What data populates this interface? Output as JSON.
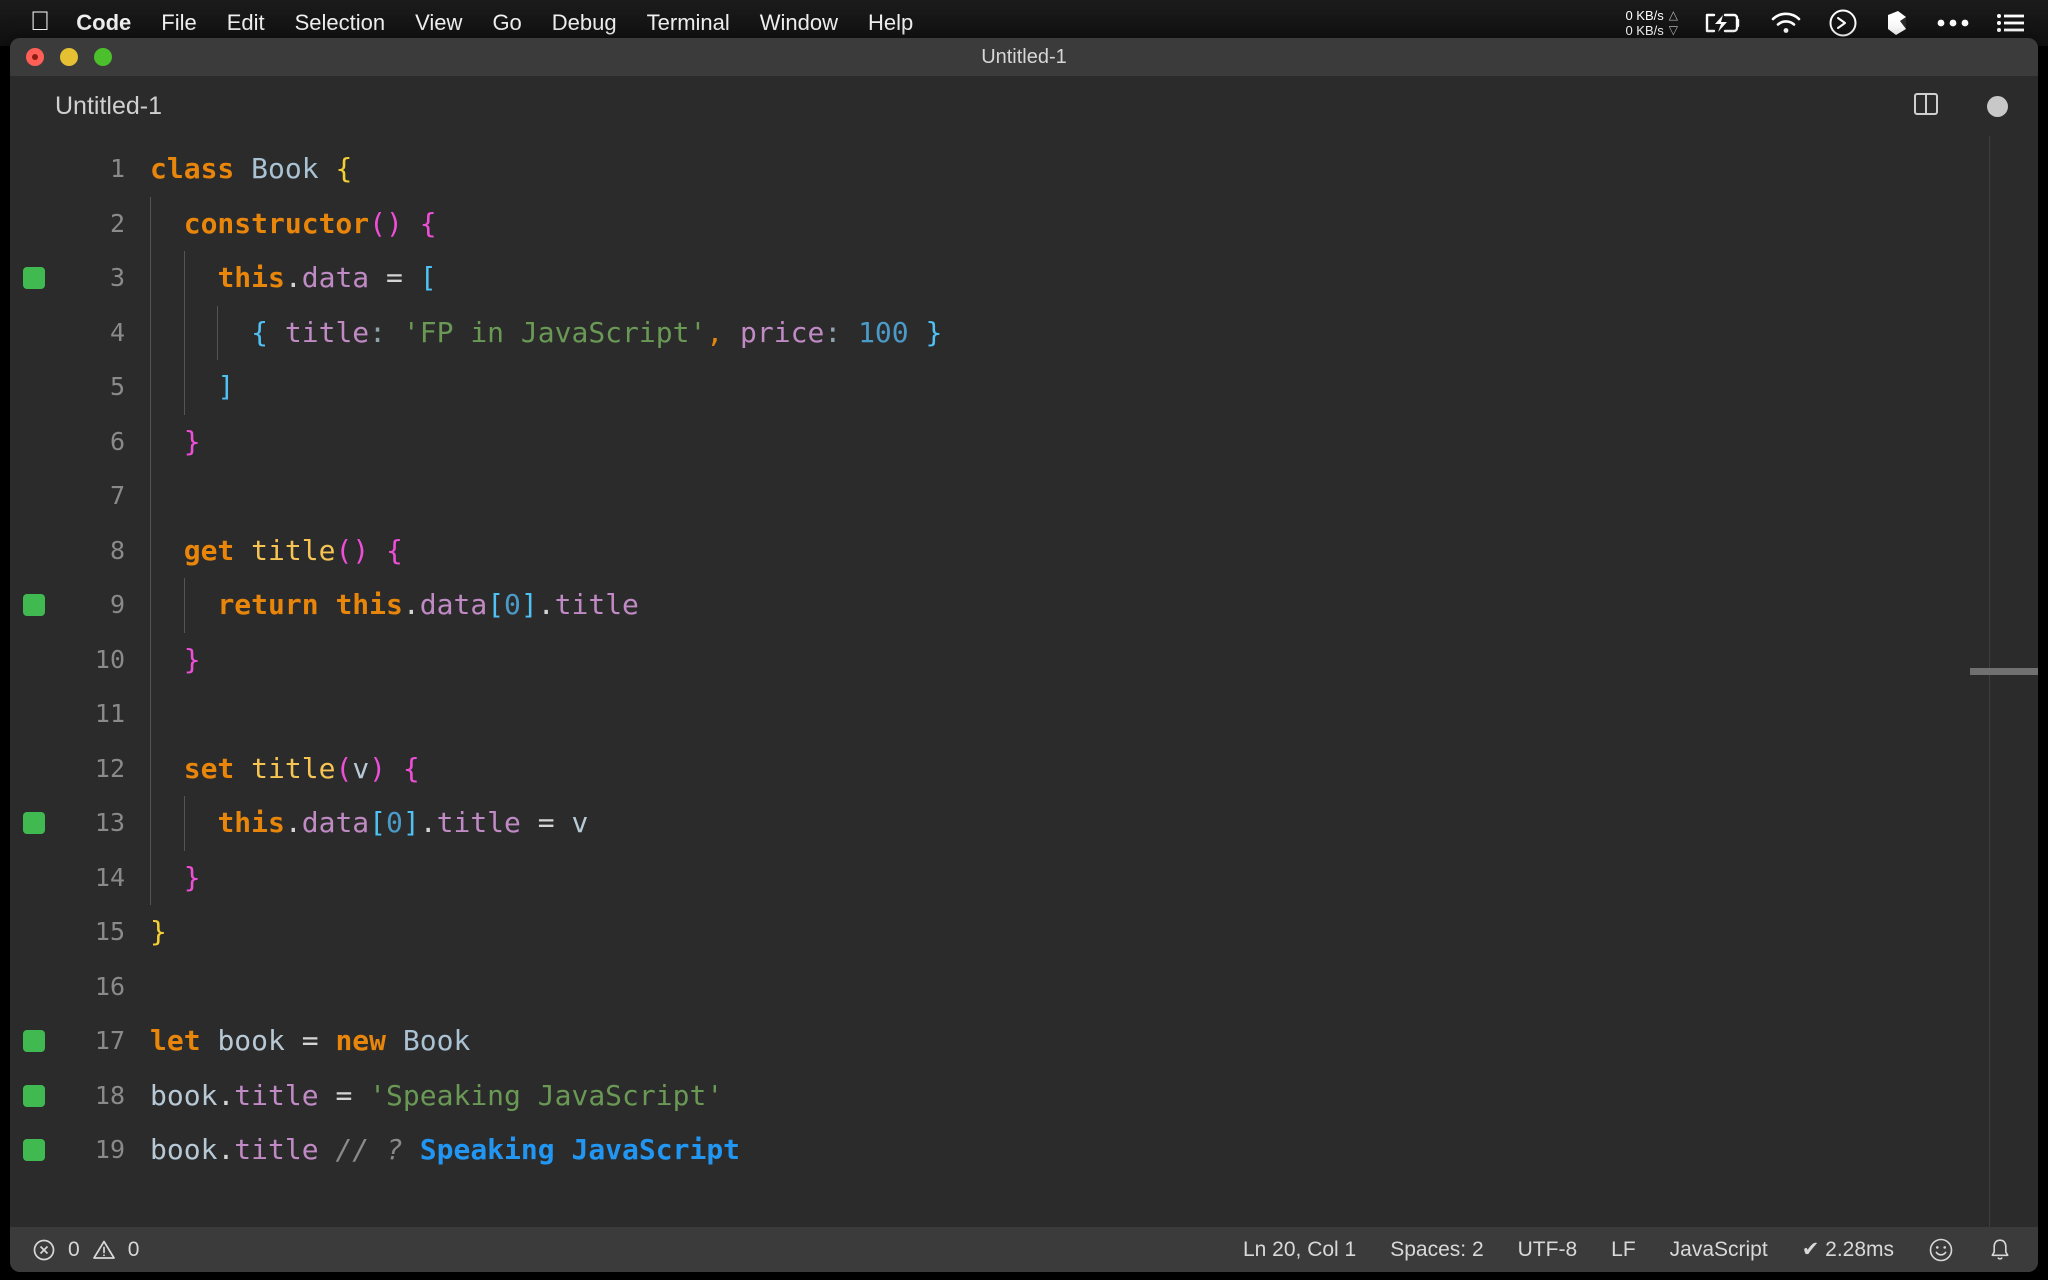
{
  "menubar": {
    "apple_icon": "apple-logo-icon",
    "items": [
      {
        "label": "Code",
        "bold": true
      },
      {
        "label": "File",
        "bold": false
      },
      {
        "label": "Edit",
        "bold": false
      },
      {
        "label": "Selection",
        "bold": false
      },
      {
        "label": "View",
        "bold": false
      },
      {
        "label": "Go",
        "bold": false
      },
      {
        "label": "Debug",
        "bold": false
      },
      {
        "label": "Terminal",
        "bold": false
      },
      {
        "label": "Window",
        "bold": false
      },
      {
        "label": "Help",
        "bold": false
      }
    ],
    "network": {
      "up": "0 KB/s",
      "down": "0 KB/s",
      "up_arrow": "△",
      "down_arrow": "▽"
    },
    "status_icons": [
      "battery-charging-icon",
      "wifi-icon",
      "shell-prompt-icon",
      "dropbox-icon",
      "ellipsis-icon",
      "control-center-list-icon"
    ]
  },
  "window": {
    "title": "Untitled-1",
    "traffic_lights": [
      "close-button",
      "minimize-button",
      "maximize-button"
    ]
  },
  "editor": {
    "tab_label": "Untitled-1",
    "split_icon": "split-editor-icon",
    "dirty_icon": "unsaved-dot-icon",
    "coverage_lines": [
      3,
      9,
      13,
      17,
      18,
      19
    ],
    "line_numbers": [
      1,
      2,
      3,
      4,
      5,
      6,
      7,
      8,
      9,
      10,
      11,
      12,
      13,
      14,
      15,
      16,
      17,
      18,
      19
    ]
  },
  "code": {
    "lines": [
      {
        "n": 1,
        "text": "class Book {"
      },
      {
        "n": 2,
        "text": "  constructor() {"
      },
      {
        "n": 3,
        "text": "    this.data = ["
      },
      {
        "n": 4,
        "text": "      { title: 'FP in JavaScript', price: 100 }"
      },
      {
        "n": 5,
        "text": "    ]"
      },
      {
        "n": 6,
        "text": "  }"
      },
      {
        "n": 7,
        "text": ""
      },
      {
        "n": 8,
        "text": "  get title() {"
      },
      {
        "n": 9,
        "text": "    return this.data[0].title"
      },
      {
        "n": 10,
        "text": "  }"
      },
      {
        "n": 11,
        "text": ""
      },
      {
        "n": 12,
        "text": "  set title(v) {"
      },
      {
        "n": 13,
        "text": "    this.data[0].title = v"
      },
      {
        "n": 14,
        "text": "  }"
      },
      {
        "n": 15,
        "text": "}"
      },
      {
        "n": 16,
        "text": ""
      },
      {
        "n": 17,
        "text": "let book = new Book"
      },
      {
        "n": 18,
        "text": "book.title = 'Speaking JavaScript'"
      },
      {
        "n": 19,
        "text": "book.title // ? Speaking JavaScript"
      }
    ],
    "inline_result": "Speaking JavaScript",
    "inline_result_marker": "// ?",
    "colors": {
      "background": "#2b2b2b",
      "keyword": "#e8850b",
      "class_name": "#a9c2d4",
      "property": "#c08ac4",
      "function": "#f6c453",
      "string": "#6a9955",
      "number": "#4a9bc9",
      "bracket_level_1": "#f5d033",
      "bracket_level_2": "#ef4fd8",
      "bracket_level_3": "#4fc1f5",
      "comment": "#8a8a8a",
      "quokka_result": "#2196f3",
      "coverage_green": "#3fb950",
      "line_number": "#8a8a8a"
    }
  },
  "statusbar": {
    "error_icon": "error-circle-icon",
    "error_count": "0",
    "warning_icon": "warning-triangle-icon",
    "warning_count": "0",
    "cursor_position": "Ln 20, Col 1",
    "indentation": "Spaces: 2",
    "encoding": "UTF-8",
    "eol": "LF",
    "language": "JavaScript",
    "quokka_time": "✔ 2.28ms",
    "feedback_icon": "smiley-icon",
    "notifications_icon": "bell-icon"
  }
}
